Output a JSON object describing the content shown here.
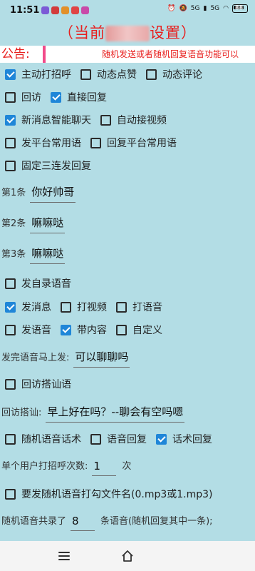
{
  "status": {
    "time": "11:51",
    "net1": "5G",
    "net2": "5G",
    "battery": "88"
  },
  "title": {
    "open": "（当前",
    "close": "设置）"
  },
  "notice": {
    "label": "公告:",
    "text": "随机发送或者随机回复语音功能可以"
  },
  "options": {
    "main_greet": "主动打招呼",
    "like_post": "动态点赞",
    "comment_post": "动态评论",
    "revisit": "回访",
    "direct_reply": "直接回复",
    "smart_chat": "新消息智能聊天",
    "auto_video": "自动接视频",
    "send_common": "发平台常用语",
    "reply_common": "回复平台常用语",
    "fixed_triple": "固定三连发回复",
    "send_own_voice": "发自录语音",
    "send_msg": "发消息",
    "video_call": "打视频",
    "voice_call": "打语音",
    "send_voice": "发语音",
    "with_content": "带内容",
    "custom": "自定义",
    "revisit_chat": "回访搭讪语",
    "random_voice_script": "随机语音话术",
    "voice_reply": "语音回复",
    "script_reply": "话术回复",
    "random_voice_file": "要发随机语音打勾文件名(0.mp3或1.mp3)"
  },
  "fields": {
    "msg1_label": "第1条",
    "msg1_value": "你好帅哥",
    "msg2_label": "第2条",
    "msg2_value": "嘛嘛哒",
    "msg3_label": "第3条",
    "msg3_value": "嘛嘛哒",
    "after_voice_label": "发完语音马上发:",
    "after_voice_value": "可以聊聊吗",
    "revisit_label": "回访搭讪:",
    "revisit_value": "早上好在吗？--聊会有空吗嗯",
    "greet_count_label": "单个用户打招呼次数:",
    "greet_count_value": "1",
    "greet_count_unit": "次",
    "voice_total_label": "随机语音共录了",
    "voice_total_value": "8",
    "voice_total_unit": "条语音(随机回复其中一条);"
  }
}
